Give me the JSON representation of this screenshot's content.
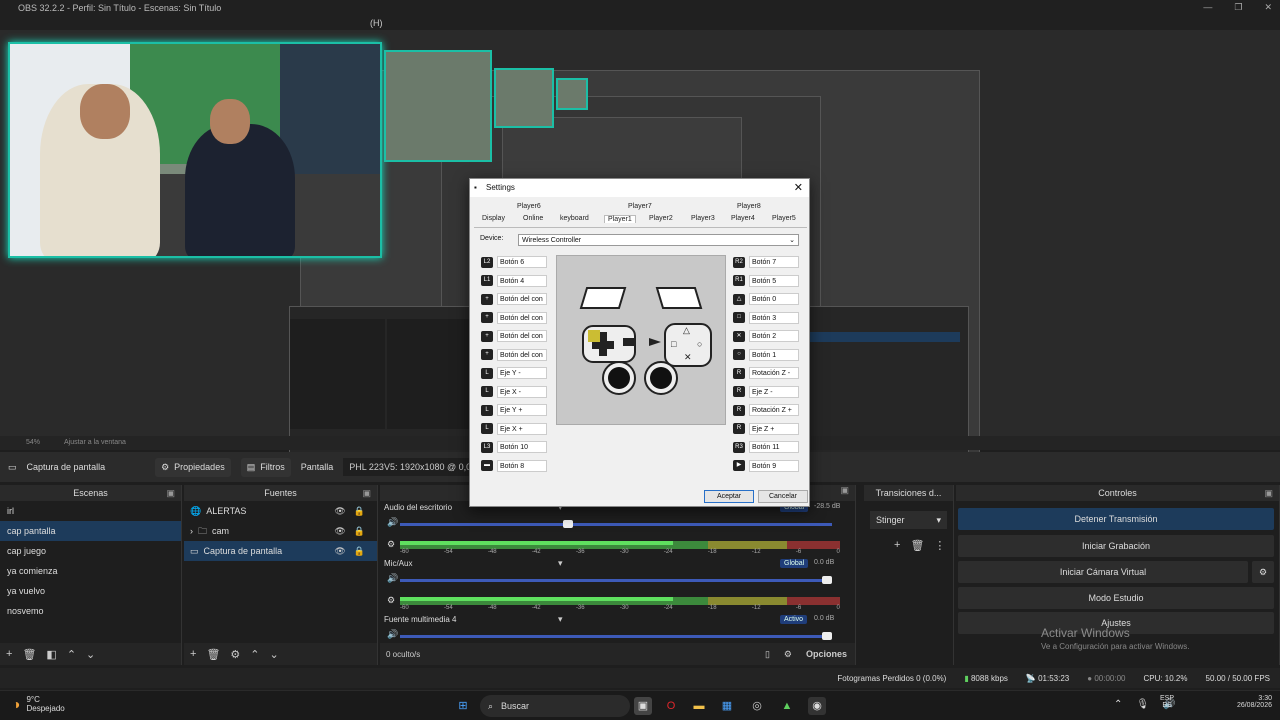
{
  "window": {
    "title": "OBS 32.2.2 - Perfil: Sin Título - Escenas: Sin Título",
    "help_menu": "(H)"
  },
  "zoom": {
    "value": "54%",
    "fit": "Ajustar a la ventana"
  },
  "source_toolbar": {
    "current_source": "Captura de pantalla",
    "properties": "Propiedades",
    "filters": "Filtros",
    "screen_label": "Pantalla",
    "resolution": "PHL 223V5: 1920x1080 @ 0,0 (Mon"
  },
  "scenes": {
    "header": "Escenas",
    "items": [
      "irl",
      "cap pantalla",
      "cap juego",
      "ya comienza",
      "ya vuelvo",
      "nosvemo"
    ],
    "selected_index": 1
  },
  "sources": {
    "header": "Fuentes",
    "items": [
      {
        "name": "ALERTAS",
        "icon": "globe-icon"
      },
      {
        "name": "cam",
        "icon": "folder-icon"
      },
      {
        "name": "Captura de pantalla",
        "icon": "monitor-icon"
      }
    ]
  },
  "mixer": {
    "tracks": [
      {
        "name": "Audio del escritorio",
        "badge": "Global",
        "db": "-28.5 dB",
        "volume": 0.4
      },
      {
        "name": "Mic/Aux",
        "badge": "Global",
        "db": "0.0 dB",
        "volume": 1.0
      },
      {
        "name": "Fuente multimedia 4",
        "badge": "Activo",
        "db": "0.0 dB",
        "volume": 1.0
      }
    ],
    "ticks": [
      "-60",
      "-54",
      "-48",
      "-42",
      "-36",
      "-30",
      "-24",
      "-18",
      "-12",
      "-6",
      "0"
    ],
    "hidden_count": "0 oculto/s",
    "options": "Opciones"
  },
  "transitions": {
    "header": "Transiciones d...",
    "selected": "Stinger"
  },
  "controls": {
    "header": "Controles",
    "buttons": [
      "Detener Transmisión",
      "Iniciar Grabación",
      "Iniciar Cámara Virtual",
      "Modo Estudio",
      "Ajustes"
    ]
  },
  "activate_windows": {
    "title": "Activar Windows",
    "subtitle": "Ve a Configuración para activar Windows."
  },
  "status": {
    "dropped": "Fotogramas Perdidos 0 (0.0%)",
    "bitrate": "8088 kbps",
    "stream_time": "01:53:23",
    "rec_time": "00:00:00",
    "cpu": "CPU: 10.2%",
    "fps": "50.00 / 50.00 FPS"
  },
  "taskbar": {
    "weather_temp": "9°C",
    "weather_desc": "Despejado",
    "search": "Buscar",
    "lang": "ESP",
    "lang_sub": "ES",
    "time": "3:30",
    "date": "26/08/2026"
  },
  "settings_dialog": {
    "title": "Settings",
    "tabs_top": [
      "Player6",
      "Player7",
      "Player8"
    ],
    "tabs_bottom": [
      "Display",
      "Online",
      "keyboard",
      "Player1",
      "Player2",
      "Player3",
      "Player4",
      "Player5"
    ],
    "active_tab": "Player1",
    "device_label": "Device:",
    "device_value": "Wireless Controller",
    "left_mappings": [
      {
        "glyph": "L2",
        "label": "Botón 6"
      },
      {
        "glyph": "L1",
        "label": "Botón 4"
      },
      {
        "glyph": "+",
        "label": "Botón del con"
      },
      {
        "glyph": "+",
        "label": "Botón del con"
      },
      {
        "glyph": "+",
        "label": "Botón del con"
      },
      {
        "glyph": "+",
        "label": "Botón del con"
      },
      {
        "glyph": "L",
        "label": "Eje Y -"
      },
      {
        "glyph": "L",
        "label": "Eje X -"
      },
      {
        "glyph": "L",
        "label": "Eje Y +"
      },
      {
        "glyph": "L",
        "label": "Eje X +"
      },
      {
        "glyph": "L3",
        "label": "Botón 10"
      },
      {
        "glyph": "▬",
        "label": "Botón 8"
      }
    ],
    "right_mappings": [
      {
        "glyph": "R2",
        "label": "Botón 7"
      },
      {
        "glyph": "R1",
        "label": "Botón 5"
      },
      {
        "glyph": "△",
        "label": "Botón 0"
      },
      {
        "glyph": "□",
        "label": "Botón 3"
      },
      {
        "glyph": "✕",
        "label": "Botón 2"
      },
      {
        "glyph": "○",
        "label": "Botón 1"
      },
      {
        "glyph": "R",
        "label": "Rotación Z -"
      },
      {
        "glyph": "R",
        "label": "Eje Z -"
      },
      {
        "glyph": "R",
        "label": "Rotación Z +"
      },
      {
        "glyph": "R",
        "label": "Eje Z +"
      },
      {
        "glyph": "R3",
        "label": "Botón 11"
      },
      {
        "glyph": "▶",
        "label": "Botón 9"
      }
    ],
    "accept": "Aceptar",
    "cancel": "Cancelar"
  }
}
